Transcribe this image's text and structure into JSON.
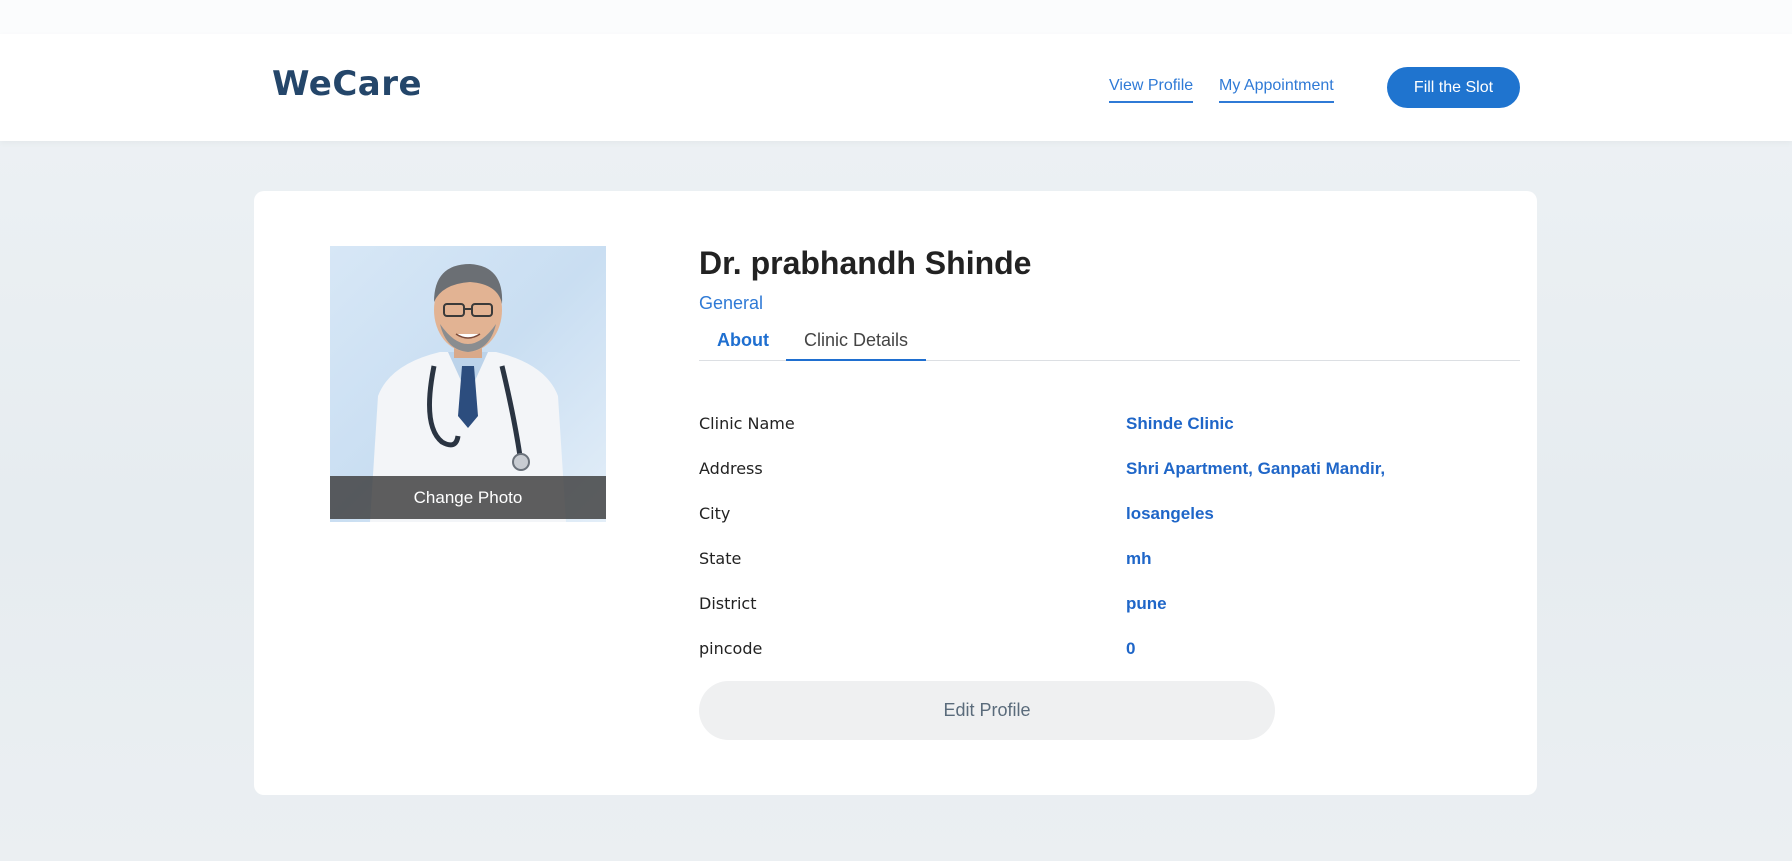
{
  "header": {
    "brand": "WeCare",
    "nav": [
      {
        "label": "View Profile"
      },
      {
        "label": "My Appointment"
      }
    ],
    "cta_label": "Fill the Slot"
  },
  "profile": {
    "name": "Dr. prabhandh Shinde",
    "specialty": "General",
    "change_photo_label": "Change Photo",
    "tabs": [
      {
        "label": "About",
        "active": false
      },
      {
        "label": "Clinic Details",
        "active": true
      }
    ],
    "details": [
      {
        "label": "Clinic Name",
        "value": "Shinde Clinic"
      },
      {
        "label": "Address",
        "value": "Shri Apartment, Ganpati Mandir,"
      },
      {
        "label": "City",
        "value": "losangeles"
      },
      {
        "label": "State",
        "value": "mh"
      },
      {
        "label": "District",
        "value": "pune"
      },
      {
        "label": "pincode",
        "value": "0"
      }
    ],
    "edit_label": "Edit Profile"
  },
  "colors": {
    "brand": "#24466a",
    "accent": "#1f74cf",
    "link": "#2f7ad6"
  }
}
